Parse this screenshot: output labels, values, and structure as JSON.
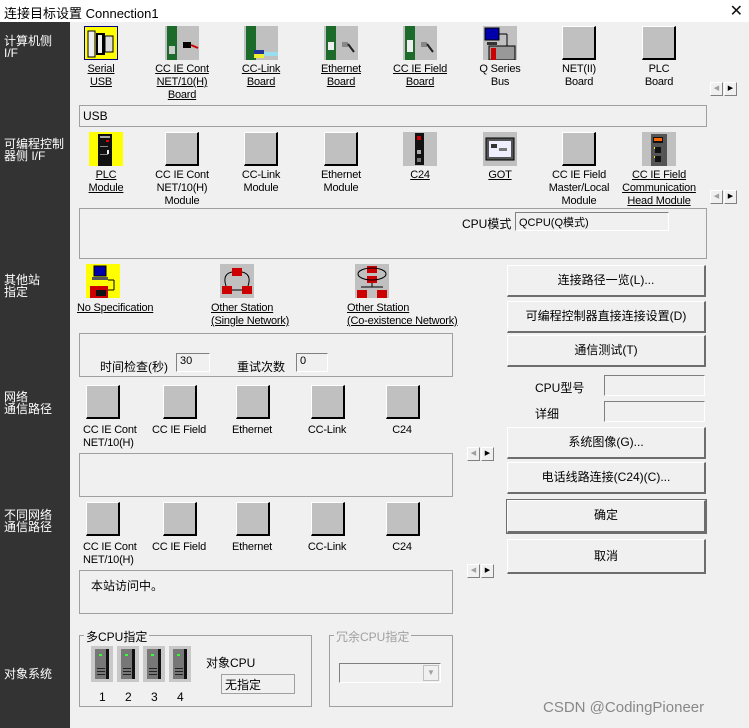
{
  "window": {
    "title": "连接目标设置 Connection1",
    "close_symbol": "✕"
  },
  "sidebar": {
    "pc_if": [
      "计算机侧",
      "I/F"
    ],
    "plc_if": [
      "可编程控制",
      "器侧 I/F"
    ],
    "other_station": [
      "其他站",
      "指定"
    ],
    "network_route": [
      "网络",
      "通信路径"
    ],
    "diff_network_route": [
      "不同网络",
      "通信路径"
    ],
    "target_system": "对象系统"
  },
  "pc_side": {
    "items": [
      {
        "lines": [
          "Serial",
          "USB"
        ],
        "icon": "serial-usb-icon",
        "selected": true,
        "link": true
      },
      {
        "lines": [
          "CC IE Cont",
          "NET/10(H)",
          "Board"
        ],
        "icon": "cc-ie-cont-board-icon",
        "link": true
      },
      {
        "lines": [
          "CC-Link",
          "Board"
        ],
        "icon": "cc-link-board-icon",
        "link": true
      },
      {
        "lines": [
          "Ethernet",
          "Board"
        ],
        "icon": "ethernet-board-icon",
        "link": true
      },
      {
        "lines": [
          "CC IE Field",
          "Board"
        ],
        "icon": "cc-ie-field-board-icon",
        "link": true
      },
      {
        "lines": [
          "Q Series",
          "Bus"
        ],
        "icon": "q-series-bus-icon",
        "link": false
      },
      {
        "lines": [
          "NET(II)",
          "Board"
        ],
        "icon": "blank-icon",
        "link": false
      },
      {
        "lines": [
          "PLC",
          "Board"
        ],
        "icon": "blank-icon",
        "link": false
      }
    ],
    "detail": "USB"
  },
  "plc_side": {
    "items": [
      {
        "lines": [
          "PLC",
          "Module"
        ],
        "icon": "plc-module-icon",
        "selected": true,
        "link": true
      },
      {
        "lines": [
          "CC IE Cont",
          "NET/10(H)",
          "Module"
        ],
        "icon": "blank-icon",
        "link": false
      },
      {
        "lines": [
          "CC-Link",
          "Module"
        ],
        "icon": "blank-icon",
        "link": false
      },
      {
        "lines": [
          "Ethernet",
          "Module"
        ],
        "icon": "blank-icon",
        "link": false
      },
      {
        "lines": [
          "C24"
        ],
        "icon": "c24-icon",
        "link": true
      },
      {
        "lines": [
          "GOT"
        ],
        "icon": "got-icon",
        "link": true
      },
      {
        "lines": [
          "CC IE Field",
          "Master/Local",
          "Module"
        ],
        "icon": "blank-icon",
        "link": false
      },
      {
        "lines": [
          "CC IE Field",
          "Communication",
          "Head Module"
        ],
        "icon": "head-module-icon",
        "link": true
      }
    ],
    "cpu_mode_label": "CPU模式",
    "cpu_mode_value": "QCPU(Q模式)"
  },
  "other_station": {
    "items": [
      {
        "lines": [
          "No Specification"
        ],
        "icon": "no-specification-icon",
        "selected": true
      },
      {
        "lines": [
          "Other Station",
          "(Single Network)"
        ],
        "icon": "single-network-icon"
      },
      {
        "lines": [
          "Other Station",
          "(Co-existence Network)"
        ],
        "icon": "coexistence-network-icon"
      }
    ],
    "time_check_label": "时间检查(秒)",
    "time_check_value": "30",
    "retry_label": "重试次数",
    "retry_value": "0"
  },
  "network_route": {
    "items": [
      [
        "CC IE Cont",
        "NET/10(H)"
      ],
      [
        "CC IE Field"
      ],
      [
        "Ethernet"
      ],
      [
        "CC-Link"
      ],
      [
        "C24"
      ]
    ]
  },
  "diff_network_route": {
    "items": [
      [
        "CC IE Cont",
        "NET/10(H)"
      ],
      [
        "CC IE Field"
      ],
      [
        "Ethernet"
      ],
      [
        "CC-Link"
      ],
      [
        "C24"
      ]
    ],
    "status": "本站访问中。"
  },
  "buttons": {
    "route_list": "连接路径一览(L)...",
    "direct_connect": "可编程控制器直接连接设置(D)",
    "comm_test": "通信测试(T)",
    "system_image": "系统图像(G)...",
    "phone_line": "电话线路连接(C24)(C)...",
    "ok": "确定",
    "cancel": "取消"
  },
  "cpu_info": {
    "model_label": "CPU型号",
    "model_value": "",
    "detail_label": "详细",
    "detail_value": ""
  },
  "multi_cpu": {
    "title": "多CPU指定",
    "cpus": [
      "1",
      "2",
      "3",
      "4"
    ],
    "target_label": "对象CPU",
    "target_value": "无指定"
  },
  "redundant_cpu": {
    "title": "冗余CPU指定",
    "value": ""
  },
  "scroll": {
    "left": "◀",
    "right": "▶"
  },
  "watermark": "CSDN @CodingPioneer"
}
